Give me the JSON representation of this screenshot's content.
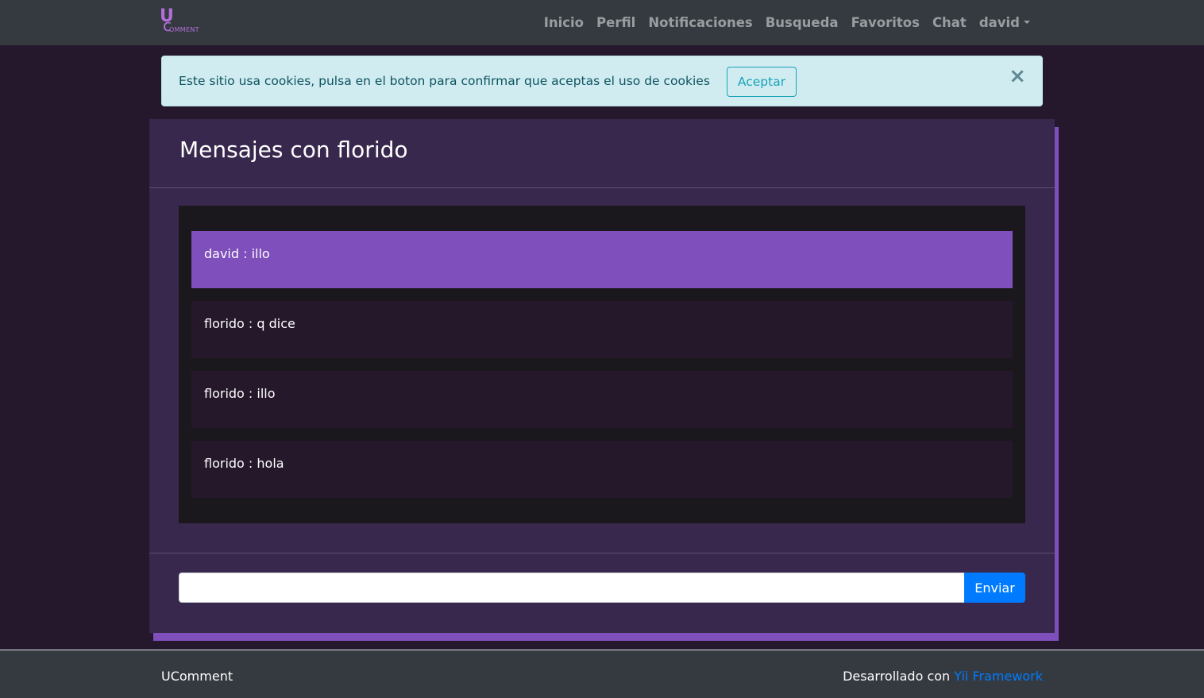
{
  "navbar": {
    "logo": {
      "letter": "U",
      "text": "OMMENT"
    },
    "links": [
      "Inicio",
      "Perfil",
      "Notificaciones",
      "Busqueda",
      "Favoritos",
      "Chat"
    ],
    "user_menu": "david"
  },
  "alert": {
    "text": "Este sitio usa cookies, pulsa en el boton para confirmar que aceptas el uso de cookies",
    "accept_label": "Aceptar",
    "close_symbol": "×"
  },
  "chat": {
    "title": "Mensajes con florido",
    "messages": [
      {
        "text": "david : illo",
        "own": true
      },
      {
        "text": "florido : q dice",
        "own": false
      },
      {
        "text": "florido : illo",
        "own": false
      },
      {
        "text": "florido : hola",
        "own": false
      }
    ],
    "input_value": "",
    "send_label": "Enviar"
  },
  "footer": {
    "brand": "UComment",
    "credit_prefix": "Desarrollado con ",
    "credit_link": "Yii Framework"
  },
  "colors": {
    "accent": "#7f4fbb",
    "page_bg": "#25182c",
    "card_bg": "#39284d",
    "navbar_bg": "#343a40",
    "primary_button": "#007bff",
    "alert_bg": "#d1ecf1"
  },
  "icons": {
    "close": "close-icon",
    "dropdown": "chevron-down-icon"
  }
}
